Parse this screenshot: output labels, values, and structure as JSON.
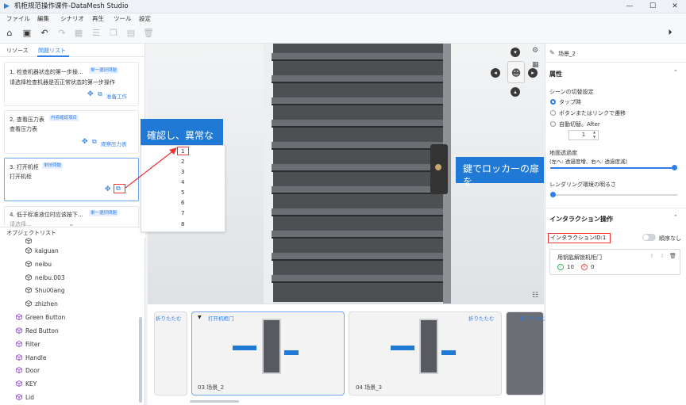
{
  "window": {
    "title": "机柜规范操作课件-DataMesh Studio",
    "controls": [
      "—",
      "☐",
      "✕"
    ]
  },
  "menu": [
    "ファイル",
    "編集",
    "シナリオ",
    "再生",
    "ツール",
    "設定"
  ],
  "left": {
    "tabs": [
      "リソース",
      "問題リスト"
    ],
    "cards": [
      {
        "title": "1. 检查机器状态的第一步操…",
        "badge": "単一選択問題",
        "sub": "请选择检查机器是否正常状态的第一步操作",
        "action": "准备工作"
      },
      {
        "title": "2. 查看压力表",
        "badge": "内容確認項目",
        "sub": "查看压力表",
        "action": "观察压力表"
      },
      {
        "title": "3. 打开机柜",
        "badge": "単技問題",
        "sub": "打开机柜"
      },
      {
        "title": "4. 低于标准液位时应该按下…",
        "badge": "単一選択問題",
        "sub": "请选择..."
      }
    ],
    "object_list_title": "オブジェクトリスト",
    "tree_children": [
      "kaiguan",
      "neibu",
      "neibu.003",
      "ShuiXiang",
      "zhizhen"
    ],
    "tree_items": [
      "Green Button",
      "Red Button",
      "Filter",
      "Handle",
      "Door",
      "KEY",
      "Lid"
    ]
  },
  "dropdown": {
    "items": [
      "1",
      "2",
      "3",
      "4",
      "5",
      "6",
      "7",
      "8"
    ]
  },
  "viewport": {
    "left_banner": "確認し、異常な",
    "right_banner": "鍵でロッカーの扉を"
  },
  "timeline": {
    "fold_label": "折りたたむ",
    "scenes": [
      {
        "label": "",
        "fold": "折りたたむ"
      },
      {
        "label": "03 场景_2",
        "title": "打开机柜门"
      },
      {
        "label": "04 场景_3",
        "fold": "折りたたむ"
      },
      {
        "label": "",
        "fold": "折りたたむ"
      }
    ]
  },
  "right": {
    "scene_name": "场景_2",
    "properties_title": "属性",
    "scene_switch_label": "シーンの切替設定",
    "radio_options": [
      "タップ時",
      "ボタンまたはリンクで遷移",
      "自動切替。After"
    ],
    "stepper_value": "1",
    "ground_label": "地面透過度",
    "ground_hint": "(左へ: 透過度増、右へ: 透過度減)",
    "ground_level": 0.98,
    "render_label": "レンダリング環境の明るさ",
    "render_level": 0.02,
    "interaction_title": "インタラクション操作",
    "interaction_id": "インタラクションID:1",
    "order_label": "順序なし",
    "action_title": "用钥匙解锁机柜门",
    "ok_count": "10",
    "ng_count": "0"
  }
}
